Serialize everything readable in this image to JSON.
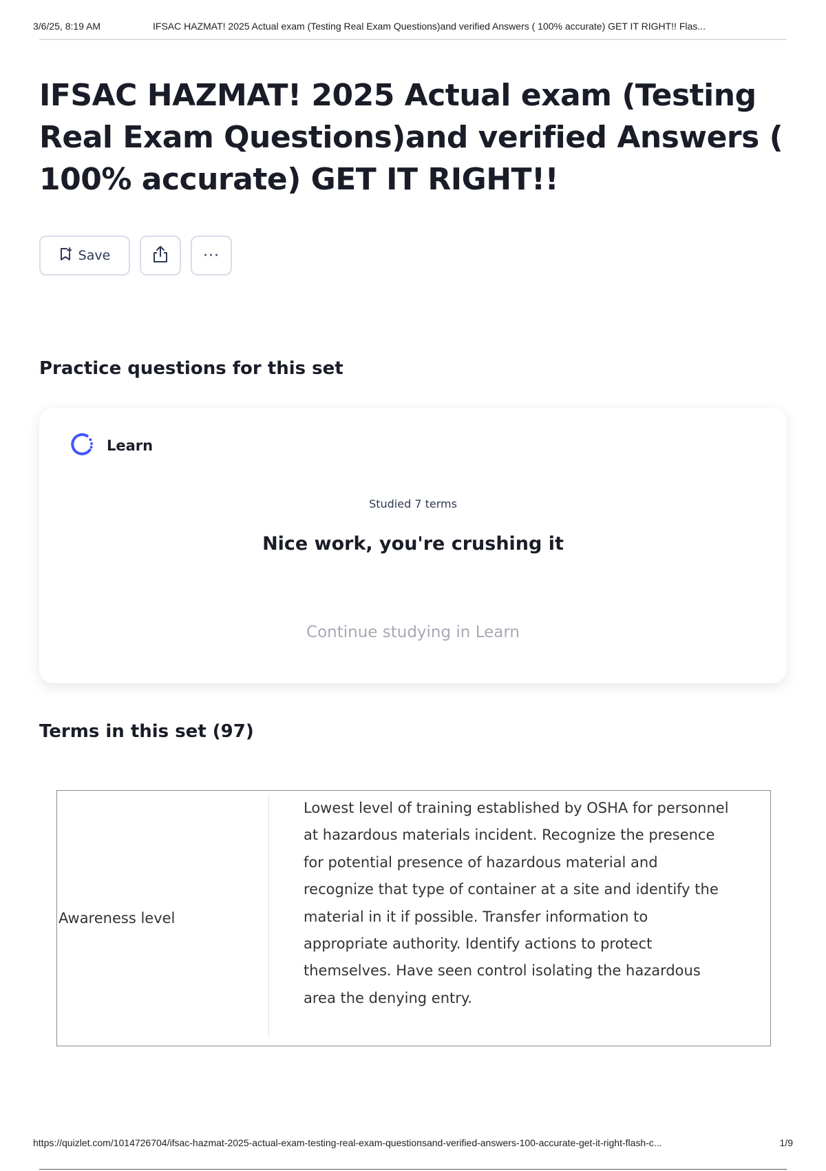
{
  "print_header": {
    "date": "3/6/25, 8:19 AM",
    "doc_title": "IFSAC HAZMAT! 2025 Actual exam (Testing Real Exam Questions)and verified Answers ( 100% accurate) GET IT RIGHT!! Flas..."
  },
  "page": {
    "title": "IFSAC HAZMAT! 2025 Actual exam (Testing Real Exam Questions)and verified Answers ( 100% accurate) GET IT RIGHT!!"
  },
  "actions": {
    "save_label": "Save",
    "more_label": "···",
    "icons": [
      "save-icon",
      "share-icon",
      "more-icon"
    ]
  },
  "practice": {
    "heading": "Practice questions for this set",
    "mode_label": "Learn",
    "mode_icon": "learn-progress-icon",
    "studied_text": "Studied 7 terms",
    "encouragement": "Nice work, you're crushing it",
    "continue_label": "Continue studying in Learn"
  },
  "terms": {
    "heading": "Terms in this set (97)",
    "rows": [
      {
        "term": "Awareness level",
        "definition": "Lowest level of training established by OSHA for personnel at hazardous materials incident. Recognize the presence for potential presence of hazardous material and recognize that type of container at a site and identify the material in it if possible. Transfer information to appropriate authority. Identify actions to protect themselves. Have seen control isolating the hazardous area the denying entry."
      }
    ]
  },
  "print_footer": {
    "url": "https://quizlet.com/1014726704/ifsac-hazmat-2025-actual-exam-testing-real-exam-questionsand-verified-answers-100-accurate-get-it-right-flash-c...",
    "page_number": "1/9"
  },
  "colors": {
    "accent_learn": "#4255ff",
    "text_primary": "#1a1d28",
    "text_muted": "#a6aab4",
    "border": "#d9dde8"
  }
}
